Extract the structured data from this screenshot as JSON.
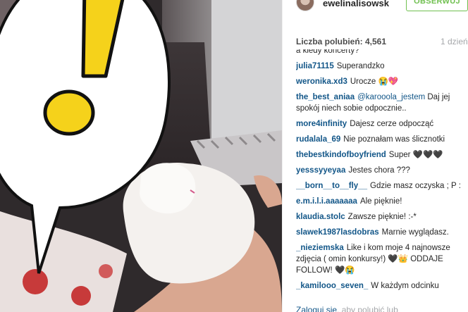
{
  "header": {
    "username": "ewelinalisowsk",
    "follow_label": "OBSERWUJ"
  },
  "likes": {
    "label": "Liczba polubień: ",
    "count": "4,561",
    "time_ago": "1 dzień"
  },
  "comments": [
    {
      "user": "",
      "text": "a kiedy koncerty?"
    },
    {
      "user": "julia71115",
      "text": "Superandzko"
    },
    {
      "user": "weronika.xd3",
      "text": "Urocze 😭💖"
    },
    {
      "user": "the_best_aniaa",
      "mention": "@karooola_jestem",
      "text": " Daj jej spokój niech sobie odpocznie.."
    },
    {
      "user": "more4infinity",
      "text": "Dajesz cerze odpocząć"
    },
    {
      "user": "rudalala_69",
      "text": "Nie poznałam was ślicznotki"
    },
    {
      "user": "thebestkindofboyfriend",
      "text": "Super 🖤🖤🖤"
    },
    {
      "user": "yesssyyeyaa",
      "text": "Jestes chora ???"
    },
    {
      "user": "__born__to__fly__",
      "text": "Gdzie masz oczyska ; P :"
    },
    {
      "user": "e.m.i.l.i.aaaaaaa",
      "text": "Ale pięknie!"
    },
    {
      "user": "klaudia.stolc",
      "text": "Zawsze pięknie! :-*"
    },
    {
      "user": "slawek1987lasdobras",
      "text": "Marnie wyglądasz."
    },
    {
      "user": "_nieziemska",
      "text": "Like i kom moje 4 najnowsze zdjęcia ( omin konkursy!) 🖤👑 ODDAJE FOLLOW! 🖤😭"
    },
    {
      "user": "_kamilooo_seven_",
      "text": "W każdym odcinku"
    }
  ],
  "footer": {
    "login_link": "Zaloguj się",
    "login_rest": ", aby polubić lub"
  },
  "overlay": {
    "symbol": "!"
  },
  "colors": {
    "username_blue": "#125688",
    "follow_green": "#70c050",
    "exclamation_yellow": "#f5d21b"
  }
}
